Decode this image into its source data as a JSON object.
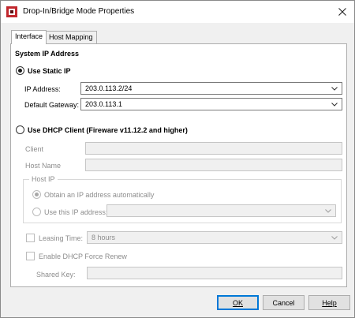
{
  "window": {
    "title": "Drop-In/Bridge Mode Properties",
    "accent_color": "#0078d7",
    "icons": {
      "app": "firebox-logo-icon",
      "close": "close-icon"
    }
  },
  "tabs": [
    {
      "label": "Interface",
      "active": true
    },
    {
      "label": "Host Mapping",
      "active": false
    }
  ],
  "section": {
    "title": "System IP Address"
  },
  "static_ip": {
    "label": "Use Static IP",
    "selected": true,
    "ip_address_label": "IP Address:",
    "ip_address_value": "203.0.113.2/24",
    "gateway_label": "Default Gateway:",
    "gateway_value": "203.0.113.1"
  },
  "dhcp": {
    "label": "Use DHCP Client (Fireware v11.12.2 and higher)",
    "selected": false,
    "client_label": "Client",
    "client_value": "",
    "host_name_label": "Host Name",
    "host_name_value": "",
    "host_ip_group": "Host IP",
    "obtain_auto_label": "Obtain an IP address automatically",
    "obtain_auto_selected": true,
    "use_this_ip_label": "Use this IP address:",
    "use_this_ip_value": "",
    "leasing_time_label": "Leasing Time:",
    "leasing_time_checked": false,
    "leasing_time_value": "8 hours",
    "force_renew_label": "Enable DHCP Force Renew",
    "force_renew_checked": false,
    "shared_key_label": "Shared Key:",
    "shared_key_value": ""
  },
  "buttons": {
    "ok": "OK",
    "cancel": "Cancel",
    "help": "Help"
  }
}
